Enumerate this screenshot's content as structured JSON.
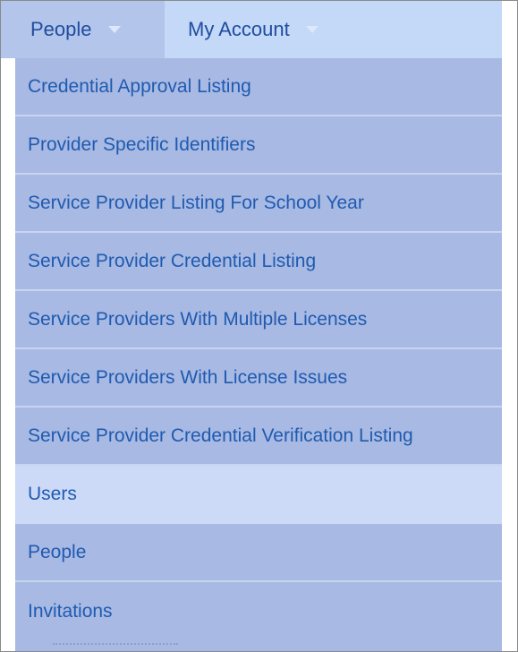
{
  "nav": {
    "tabs": [
      {
        "label": "People"
      },
      {
        "label": "My Account"
      }
    ]
  },
  "menu": {
    "items": [
      {
        "label": "Credential Approval Listing"
      },
      {
        "label": "Provider Specific Identifiers"
      },
      {
        "label": "Service Provider Listing For School Year"
      },
      {
        "label": "Service Provider Credential Listing"
      },
      {
        "label": "Service Providers With Multiple Licenses"
      },
      {
        "label": "Service Providers With License Issues"
      },
      {
        "label": "Service Provider Credential Verification Listing"
      },
      {
        "label": "Users"
      },
      {
        "label": "People"
      },
      {
        "label": "Invitations"
      }
    ],
    "active_item": "Users"
  },
  "colors": {
    "topbar": "#c4d8f8",
    "active_tab": "#b3c5eb",
    "menu_bg": "#a8b9e3",
    "menu_hover": "#ccdaf7",
    "link_text": "#1f5bb0"
  }
}
